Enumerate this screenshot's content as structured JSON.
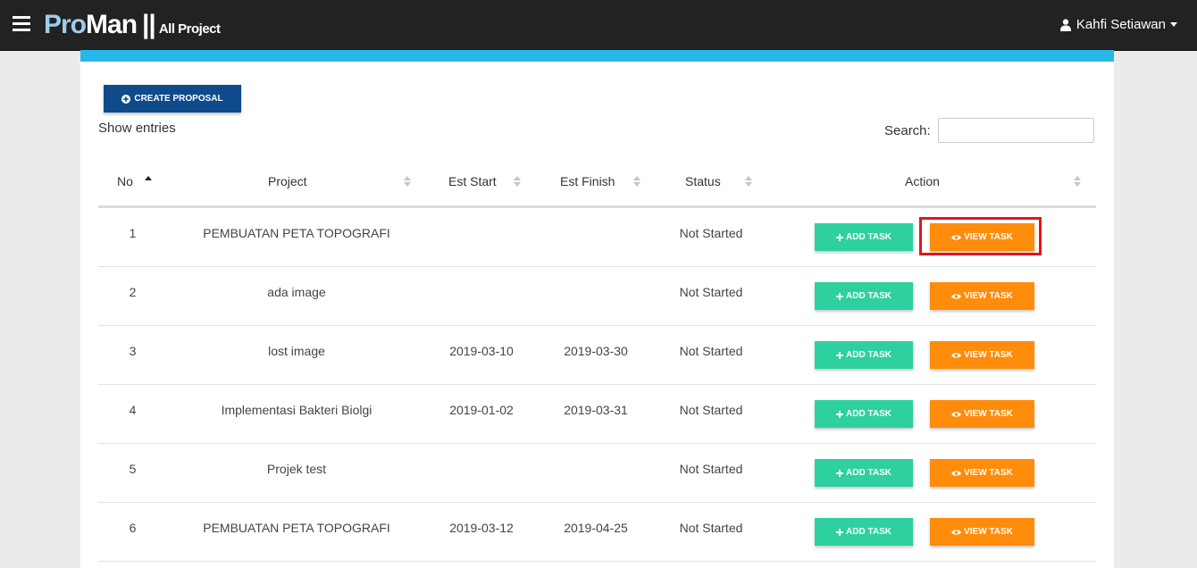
{
  "header": {
    "brand_pro": "Pro",
    "brand_man": "Man",
    "brand_sep": "||",
    "brand_sub": "All Project",
    "user_name": "Kahfi Setiawan"
  },
  "toolbar": {
    "create_label": "CREATE PROPOSAL",
    "show_entries": "Show entries",
    "search_label": "Search:",
    "search_value": ""
  },
  "table": {
    "columns": [
      "No",
      "Project",
      "Est Start",
      "Est Finish",
      "Status",
      "Action"
    ],
    "rows": [
      {
        "no": "1",
        "project": "PEMBUATAN PETA TOPOGRAFI",
        "start": "",
        "finish": "",
        "status": "Not Started"
      },
      {
        "no": "2",
        "project": "ada image",
        "start": "",
        "finish": "",
        "status": "Not Started"
      },
      {
        "no": "3",
        "project": "lost image",
        "start": "2019-03-10",
        "finish": "2019-03-30",
        "status": "Not Started"
      },
      {
        "no": "4",
        "project": "Implementasi Bakteri Biolgi",
        "start": "2019-01-02",
        "finish": "2019-03-31",
        "status": "Not Started"
      },
      {
        "no": "5",
        "project": "Projek test",
        "start": "",
        "finish": "",
        "status": "Not Started"
      },
      {
        "no": "6",
        "project": "PEMBUATAN PETA TOPOGRAFI",
        "start": "2019-03-12",
        "finish": "2019-04-25",
        "status": "Not Started"
      }
    ],
    "add_task_label": "ADD TASK",
    "view_task_label": "VIEW TASK"
  },
  "colors": {
    "topbar": "#222222",
    "accent_strip": "#29b6e8",
    "create_button": "#0f4a8a",
    "add_task": "#2ed0a0",
    "view_task": "#ff8c0a",
    "highlight": "#e0161d"
  },
  "icons": {
    "menu": "hamburger-icon",
    "user": "user-icon",
    "create": "plus-circle-icon",
    "add": "plus-icon",
    "view": "eye-icon"
  }
}
